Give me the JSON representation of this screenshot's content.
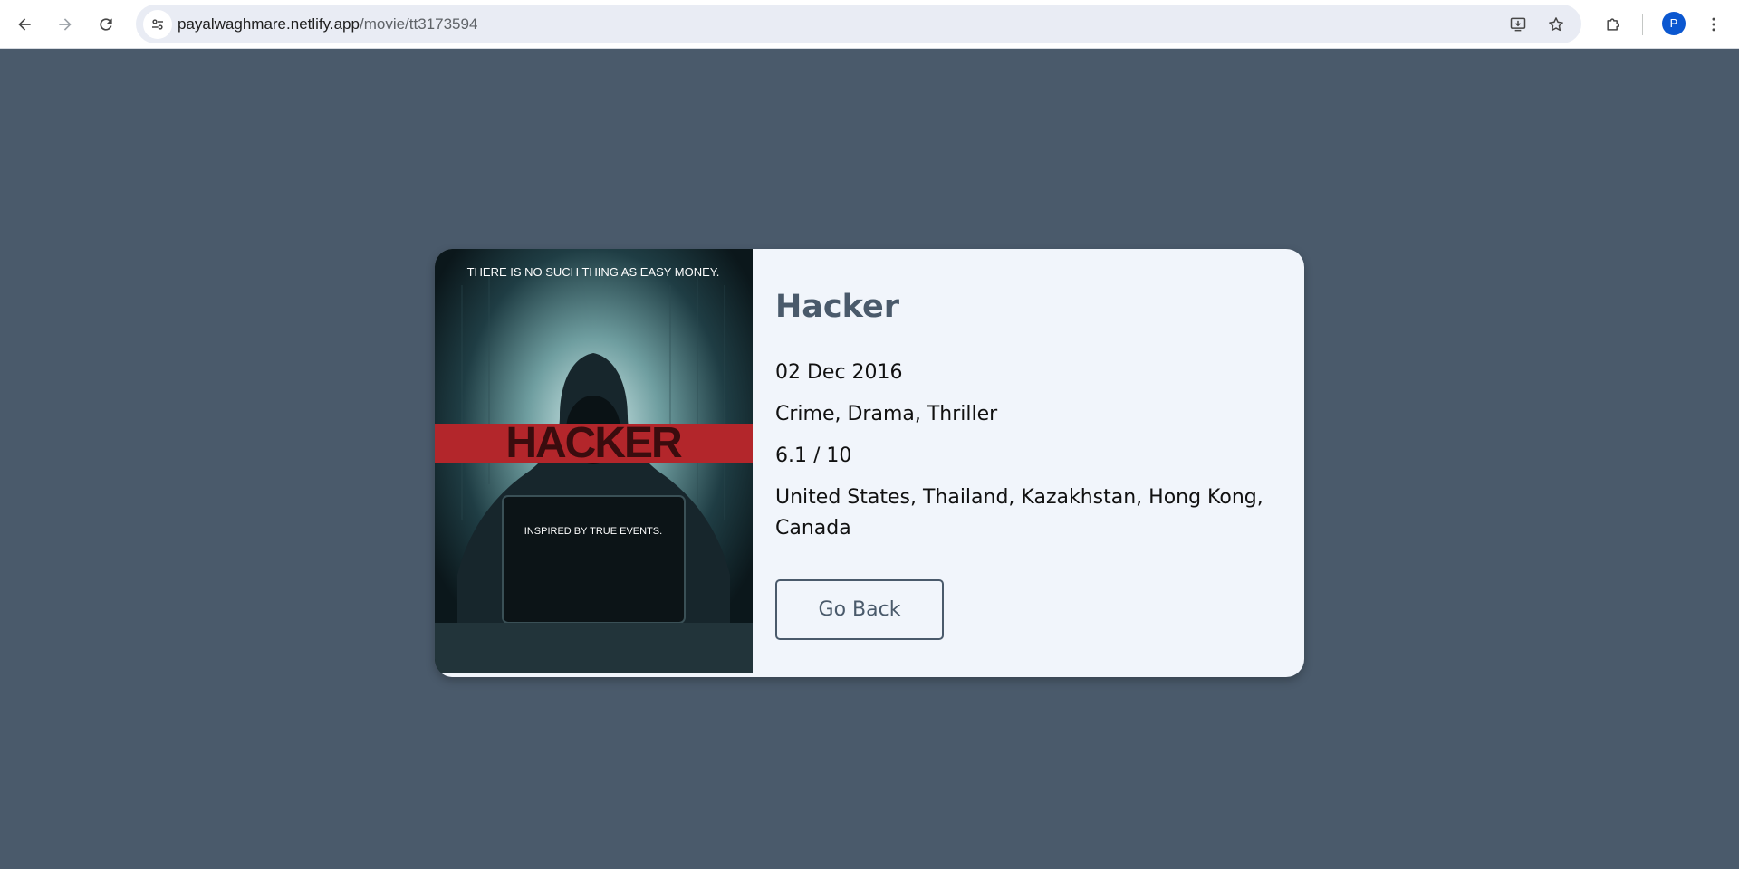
{
  "browser": {
    "url_host": "payalwaghmare.netlify.app",
    "url_path": "/movie/tt3173594",
    "profile_initial": "P",
    "icons": {
      "back": "arrow-left-icon",
      "forward": "arrow-right-icon",
      "reload": "reload-icon",
      "site_info": "tune-icon",
      "install": "install-app-icon",
      "bookmark": "star-icon",
      "extensions": "puzzle-icon",
      "menu": "kebab-menu-icon"
    }
  },
  "movie": {
    "title": "Hacker",
    "release_date": "02 Dec 2016",
    "genres": "Crime, Drama, Thriller",
    "rating": "6.1 / 10",
    "countries": "United States, Thailand, Kazakhstan, Hong Kong, Canada",
    "poster": {
      "tagline": "THERE IS NO SUCH THING AS EASY MONEY.",
      "title_text": "HACKER",
      "subtitle": "INSPIRED BY TRUE EVENTS."
    }
  },
  "actions": {
    "go_back_label": "Go Back"
  },
  "colors": {
    "page_bg": "#4a5a6b",
    "card_bg": "#f1f5fb",
    "accent": "#4a5a6b",
    "poster_band": "#b3262b"
  }
}
